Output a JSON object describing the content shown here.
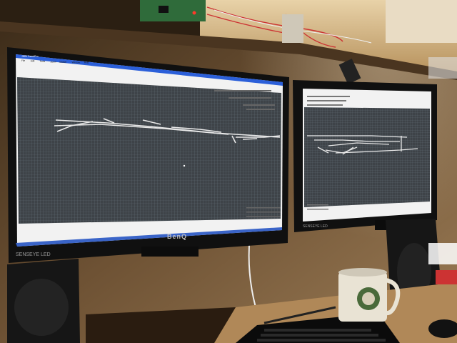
{
  "scene": {
    "description_items": [
      "left-monitor",
      "right-monitor",
      "coffee-mug",
      "keyboard",
      "speakers",
      "circuit-board"
    ]
  },
  "left_monitor": {
    "window_title": "JMRI PanelPro",
    "menu_items": [
      "File",
      "Edit",
      "Tools",
      "Zoom",
      "Marker",
      "Window",
      "Help"
    ],
    "brand": "BenQ",
    "led_label": "SENSEYE LED"
  },
  "right_monitor": {
    "led_label": "SENSEYE LED"
  },
  "colors": {
    "wall": "#8a6a45",
    "screen_grid_bg": "#3e4348",
    "grid_line": "#5d6a72",
    "track": "#e8e8e8",
    "window_chrome": "#f2f2f2",
    "title_bar": "#2b5fd9"
  }
}
